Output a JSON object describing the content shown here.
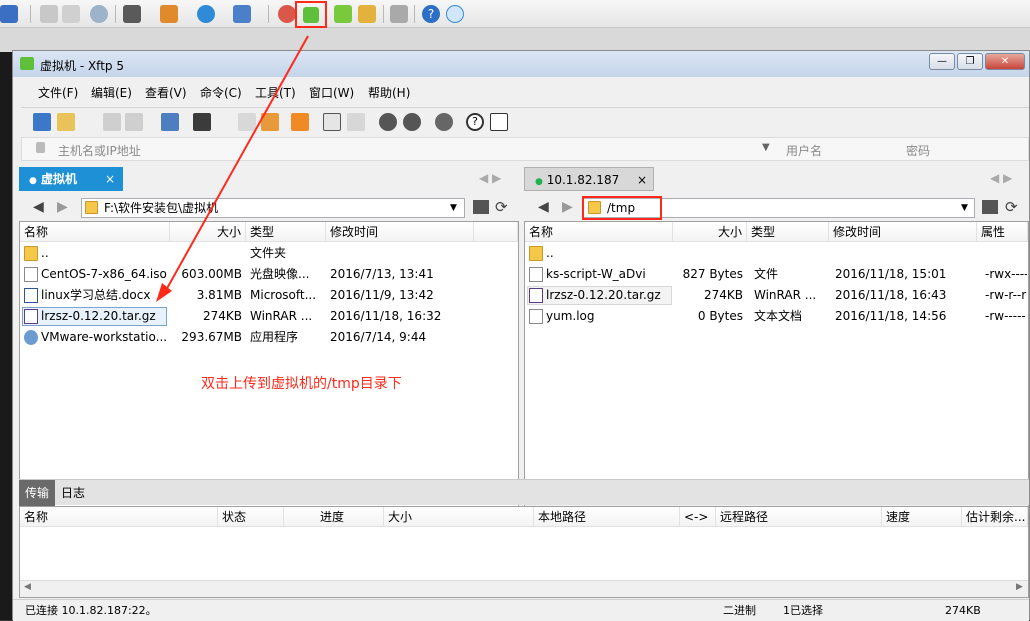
{
  "window": {
    "title": "虚拟机 - Xftp 5",
    "minimize": "—",
    "restore": "❐",
    "close": "✕"
  },
  "menu": [
    "文件(F)",
    "编辑(E)",
    "查看(V)",
    "命令(C)",
    "工具(T)",
    "窗口(W)",
    "帮助(H)"
  ],
  "address": {
    "host_placeholder": "主机名或IP地址",
    "user_placeholder": "用户名",
    "pass_placeholder": "密码"
  },
  "left": {
    "tab": "虚拟机",
    "path": "F:\\软件安装包\\虚拟机",
    "headers": [
      "名称",
      "大小",
      "类型",
      "修改时间"
    ],
    "rows": [
      {
        "name": "..",
        "size": "",
        "type": "文件夹",
        "date": ""
      },
      {
        "name": "CentOS-7-x86_64.iso",
        "size": "603.00MB",
        "type": "光盘映像...",
        "date": "2016/7/13, 13:41"
      },
      {
        "name": "linux学习总结.docx",
        "size": "3.81MB",
        "type": "Microsoft...",
        "date": "2016/11/9, 13:42"
      },
      {
        "name": "lrzsz-0.12.20.tar.gz",
        "size": "274KB",
        "type": "WinRAR ...",
        "date": "2016/11/18, 16:32"
      },
      {
        "name": "VMware-workstatio...",
        "size": "293.67MB",
        "type": "应用程序",
        "date": "2016/7/14, 9:44"
      }
    ]
  },
  "right": {
    "tab": "10.1.82.187",
    "path": "/tmp",
    "headers": [
      "名称",
      "大小",
      "类型",
      "修改时间",
      "属性"
    ],
    "rows": [
      {
        "name": "..",
        "size": "",
        "type": "",
        "date": "",
        "attr": ""
      },
      {
        "name": "ks-script-W_aDvi",
        "size": "827 Bytes",
        "type": "文件",
        "date": "2016/11/18, 15:01",
        "attr": "-rwx----"
      },
      {
        "name": "lrzsz-0.12.20.tar.gz",
        "size": "274KB",
        "type": "WinRAR ...",
        "date": "2016/11/18, 16:43",
        "attr": "-rw-r--r"
      },
      {
        "name": "yum.log",
        "size": "0 Bytes",
        "type": "文本文档",
        "date": "2016/11/18, 14:56",
        "attr": "-rw-----"
      }
    ]
  },
  "annotation": "双击上传到虚拟机的/tmp目录下",
  "transfer": {
    "tabs": [
      "传输",
      "日志"
    ],
    "headers": [
      "名称",
      "状态",
      "进度",
      "大小",
      "本地路径",
      "<->",
      "远程路径",
      "速度",
      "估计剩余..."
    ]
  },
  "status": {
    "connected": "已连接 10.1.82.187:22。",
    "mode": "二进制",
    "selected": "1已选择",
    "size": "274KB"
  },
  "colors": {
    "highlight_red": "#ff2a1a",
    "tab_active": "#1e90d6",
    "connected_dot": "#22b14c"
  }
}
